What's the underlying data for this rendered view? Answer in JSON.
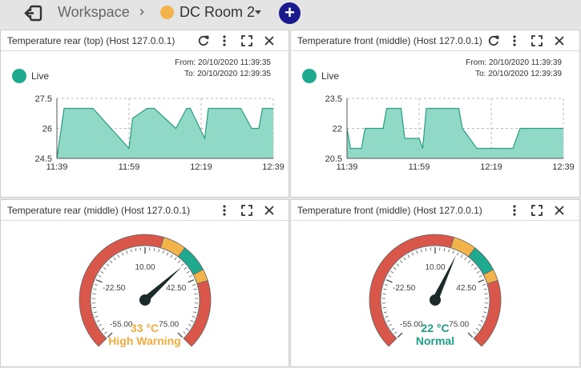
{
  "breadcrumb": {
    "workspace": "Workspace",
    "separator": "›",
    "room": "DC Room 2",
    "room_color": "#f2b34b",
    "add_label": "+",
    "add_color": "#1a1a8c"
  },
  "colors": {
    "live": "#1faa8f",
    "area_fill": "#8fd9c6",
    "area_stroke": "#2a9d82",
    "gauge_red": "#d9574a",
    "gauge_orange": "#f2b34b",
    "gauge_green": "#1faa8f",
    "warning_text": "#f0ab3c",
    "normal_text": "#1f9e86"
  },
  "panels": [
    {
      "title": "Temperature rear (top) (Host 127.0.0.1)",
      "live_label": "Live",
      "from_label": "From: 20/10/2020 11:39:35",
      "to_label": "To: 20/10/2020 12:39:35",
      "y_ticks": [
        "27.5",
        "26",
        "24.5"
      ],
      "x_ticks": [
        "11:39",
        "11:59",
        "12:19",
        "12:39"
      ]
    },
    {
      "title": "Temperature front (middle) (Host 127.0.0.1)",
      "live_label": "Live",
      "from_label": "From: 20/10/2020 11:39:39",
      "to_label": "To: 20/10/2020 12:39:39",
      "y_ticks": [
        "23.5",
        "22",
        "20.5"
      ],
      "x_ticks": [
        "11:39",
        "11:59",
        "12:19",
        "12:39"
      ]
    },
    {
      "title": "Temperature rear (middle) (Host 127.0.0.1)",
      "gauge_ticks": [
        "10.00",
        "-22.50",
        "42.50",
        "-55.00",
        "75.00"
      ],
      "value_text": "33 °C",
      "status_text": "High Warning",
      "value": 33
    },
    {
      "title": "Temperature front (middle) (Host 127.0.0.1)",
      "gauge_ticks": [
        "10.00",
        "-22.50",
        "42.50",
        "-55.00",
        "75.00"
      ],
      "value_text": "22 °C",
      "status_text": "Normal",
      "value": 22
    }
  ],
  "chart_data": [
    {
      "type": "area",
      "title": "Temperature rear (top) (Host 127.0.0.1)",
      "x_unit": "minutes",
      "x": [
        0,
        2,
        10,
        15,
        20,
        21,
        25,
        27,
        33,
        36,
        37,
        41,
        42,
        51,
        54,
        56,
        57,
        60
      ],
      "values": [
        24.5,
        27,
        27,
        26,
        25,
        26.5,
        27,
        27,
        26,
        27,
        27,
        25.5,
        27,
        27,
        26,
        26,
        27,
        27
      ],
      "ylim": [
        24.5,
        27.5
      ],
      "x_ticks": [
        "11:39",
        "11:59",
        "12:19",
        "12:39"
      ],
      "y_ticks": [
        27.5,
        26,
        24.5
      ],
      "grid": true
    },
    {
      "type": "area",
      "title": "Temperature front (middle) (Host 127.0.0.1)",
      "x_unit": "minutes",
      "x": [
        0,
        1,
        4,
        5,
        10,
        11,
        15,
        16,
        20,
        21,
        22,
        31,
        32,
        36,
        46,
        48,
        60
      ],
      "values": [
        22,
        21,
        21,
        22,
        22,
        23,
        23,
        21.5,
        21.5,
        21,
        23,
        23,
        22,
        21,
        21,
        22,
        22
      ],
      "ylim": [
        20.5,
        23.5
      ],
      "x_ticks": [
        "11:39",
        "11:59",
        "12:19",
        "12:39"
      ],
      "y_ticks": [
        23.5,
        22,
        20.5
      ],
      "grid": true
    }
  ]
}
